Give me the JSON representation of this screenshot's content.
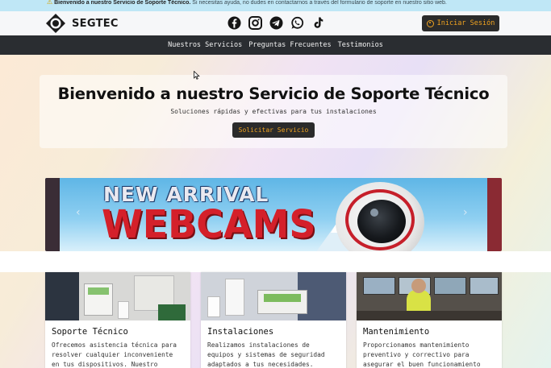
{
  "topbar": {
    "icon": "warning-icon",
    "bold": "Bienvenido a nuestro Servicio de Soporte Técnico.",
    "text": " Si necesitas ayuda, no dudes en contactarnos a través del formulario de soporte en nuestro sitio web."
  },
  "header": {
    "brand": "SEGTEC",
    "socials": [
      "facebook-icon",
      "instagram-icon",
      "telegram-icon",
      "whatsapp-icon",
      "tiktok-icon"
    ],
    "login_label": "Iniciar Sesión"
  },
  "nav": {
    "items": [
      "Nuestros Servicios",
      "Preguntas Frecuentes",
      "Testimonios"
    ]
  },
  "hero": {
    "title": "Bienvenido a nuestro Servicio de Soporte Técnico",
    "subtitle": "Soluciones rápidas y efectivas para tus instalaciones",
    "cta": "Solicitar Servicio"
  },
  "carousel": {
    "line1": "NEW ARRIVAL",
    "line2": "WEBCAMS",
    "prev": "‹",
    "next": "›"
  },
  "services": [
    {
      "title": "Soporte Técnico",
      "desc": "Ofrecemos asistencia técnica para resolver cualquier inconveniente en tus dispositivos. Nuestro"
    },
    {
      "title": "Instalaciones",
      "desc": "Realizamos instalaciones de equipos y sistemas de seguridad adaptados a tus necesidades."
    },
    {
      "title": "Mantenimiento",
      "desc": "Proporcionamos mantenimiento preventivo y correctivo para asegurar el buen funcionamiento"
    }
  ],
  "colors": {
    "accent": "#f0a320",
    "dark": "#2a2d31",
    "banner_red": "#d4202a"
  }
}
